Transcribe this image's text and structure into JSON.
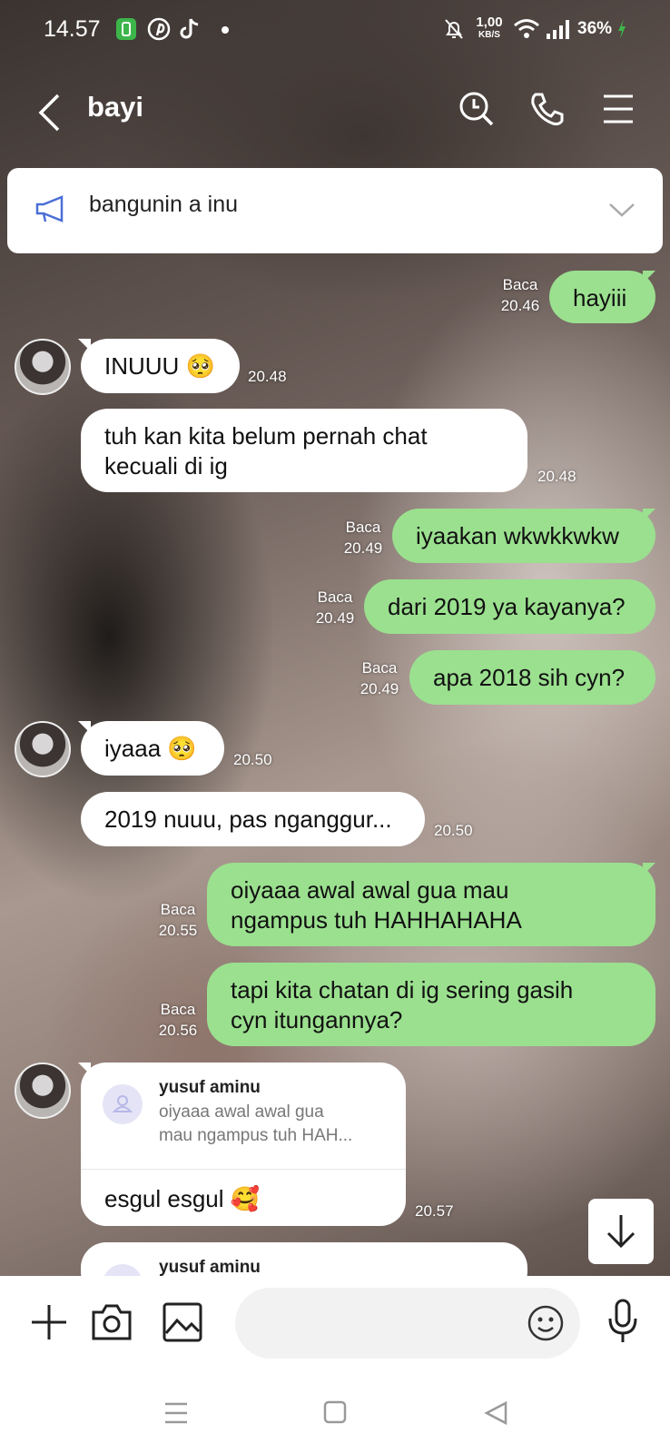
{
  "status_bar": {
    "time": "14.57",
    "speed_value": "1,00",
    "speed_unit": "KB/S",
    "battery": "36%",
    "notif_icons": [
      "app-icon",
      "pinterest-icon",
      "tiktok-icon",
      "dot-icon"
    ],
    "right_icons": [
      "mute-bell-icon",
      "wifi-icon",
      "signal-icon",
      "battery-charging-icon"
    ]
  },
  "header": {
    "title": "bayi",
    "icons": [
      "back-icon",
      "search-icon",
      "phone-icon",
      "menu-icon"
    ]
  },
  "announcement": {
    "text": "bangunin a inu",
    "icons": [
      "megaphone-icon",
      "chevron-down-icon"
    ]
  },
  "messages": [
    {
      "dir": "out",
      "lines": [
        "hayiii"
      ],
      "read": "Baca",
      "time": "20.46"
    },
    {
      "dir": "in",
      "lines": [
        "INUUU 🥺"
      ],
      "time": "20.48"
    },
    {
      "dir": "in",
      "lines": [
        "tuh kan kita belum pernah chat",
        "kecuali di ig"
      ],
      "time": "20.48"
    },
    {
      "dir": "out",
      "lines": [
        "iyaakan wkwkkwkw"
      ],
      "read": "Baca",
      "time": "20.49"
    },
    {
      "dir": "out",
      "lines": [
        "dari 2019 ya kayanya?"
      ],
      "read": "Baca",
      "time": "20.49"
    },
    {
      "dir": "out",
      "lines": [
        "apa 2018 sih cyn?"
      ],
      "read": "Baca",
      "time": "20.49"
    },
    {
      "dir": "in",
      "lines": [
        "iyaaa 🥺"
      ],
      "time": "20.50"
    },
    {
      "dir": "in",
      "lines": [
        "2019 nuuu, pas nganggur..."
      ],
      "time": "20.50"
    },
    {
      "dir": "out",
      "lines": [
        "oiyaaa awal awal gua mau",
        "ngampus tuh HAHHAHAHA"
      ],
      "read": "Baca",
      "time": "20.55"
    },
    {
      "dir": "out",
      "lines": [
        "tapi kita chatan di ig sering gasih",
        "cyn itungannya?"
      ],
      "read": "Baca",
      "time": "20.56"
    }
  ],
  "reply_message": {
    "reply_to_name": "yusuf aminu",
    "reply_snippet": [
      "oiyaaa awal awal gua",
      "mau ngampus tuh HAH..."
    ],
    "body": "esgul esgul 🥰",
    "time": "20.57"
  },
  "partial_reply": {
    "reply_to_name": "yusuf aminu"
  },
  "input_bar": {
    "placeholder": "",
    "icons": [
      "plus-icon",
      "camera-icon",
      "gallery-icon",
      "emoji-icon",
      "mic-icon"
    ]
  },
  "nav_bar": {
    "icons": [
      "recents-icon",
      "home-icon",
      "back-nav-icon"
    ]
  },
  "colors": {
    "outgoing_bubble": "#9be08f",
    "incoming_bubble": "#ffffff"
  }
}
